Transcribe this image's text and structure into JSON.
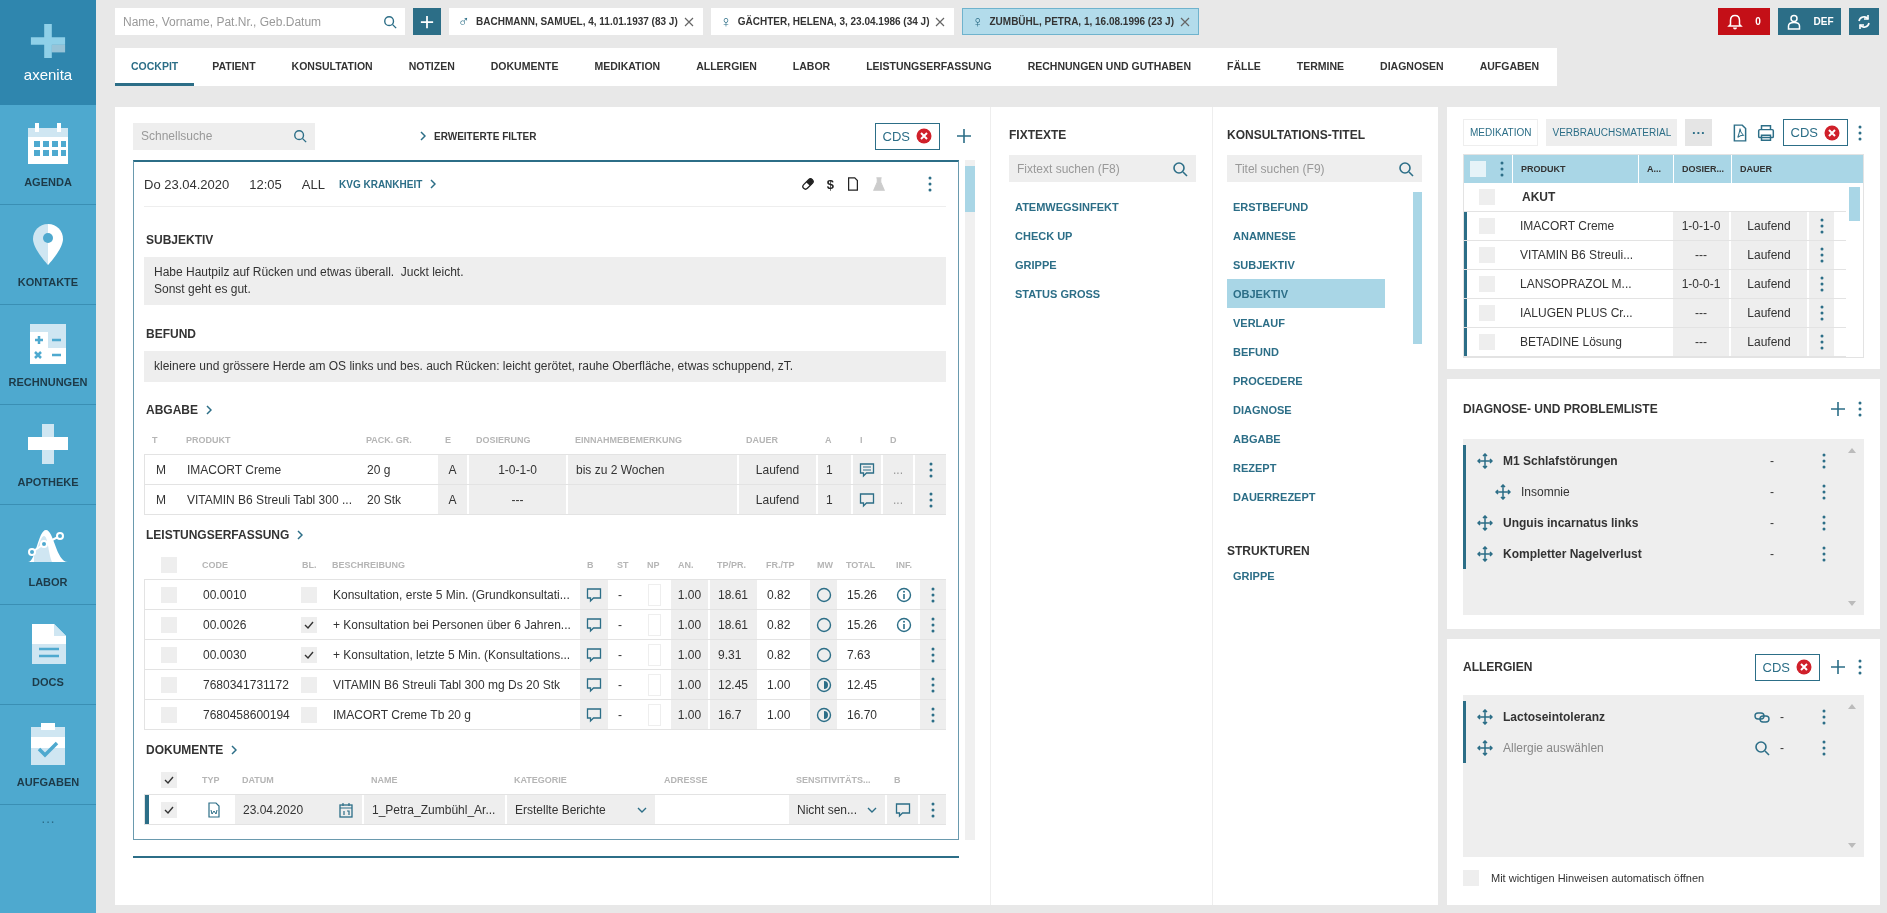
{
  "app": {
    "logo": "axenita"
  },
  "sidebar": {
    "items": [
      {
        "label": "AGENDA"
      },
      {
        "label": "KONTAKTE"
      },
      {
        "label": "RECHNUNGEN"
      },
      {
        "label": "APOTHEKE"
      },
      {
        "label": "LABOR"
      },
      {
        "label": "DOCS"
      },
      {
        "label": "AUFGABEN"
      }
    ],
    "more": "···"
  },
  "patient_search": {
    "placeholder": "Name, Vorname, Pat.Nr., Geb.Datum"
  },
  "patient_tabs": [
    {
      "symbol": "♂",
      "label": "BACHMANN, SAMUEL, 4, 11.01.1937 (83 J)",
      "selected": false
    },
    {
      "symbol": "♀",
      "label": "GÄCHTER, HELENA, 3, 23.04.1986 (34 J)",
      "selected": false
    },
    {
      "symbol": "♀",
      "label": "ZUMBÜHL, PETRA, 1, 16.08.1996 (23 J)",
      "selected": true
    }
  ],
  "notifications": {
    "count": "0"
  },
  "user": {
    "initials": "DEF"
  },
  "nav_tabs": [
    {
      "label": "COCKPIT",
      "selected": true
    },
    {
      "label": "PATIENT",
      "selected": false
    },
    {
      "label": "KONSULTATION",
      "selected": false
    },
    {
      "label": "NOTIZEN",
      "selected": false
    },
    {
      "label": "DOKUMENTE",
      "selected": false
    },
    {
      "label": "MEDIKATION",
      "selected": false
    },
    {
      "label": "ALLERGIEN",
      "selected": false
    },
    {
      "label": "LABOR",
      "selected": false
    },
    {
      "label": "LEISTUNGSERFASSUNG",
      "selected": false
    },
    {
      "label": "RECHNUNGEN UND GUTHABEN",
      "selected": false
    },
    {
      "label": "FÄLLE",
      "selected": false
    },
    {
      "label": "TERMINE",
      "selected": false
    },
    {
      "label": "DIAGNOSEN",
      "selected": false
    },
    {
      "label": "AUFGABEN",
      "selected": false
    }
  ],
  "consultation": {
    "quick_search": {
      "placeholder": "Schnellsuche"
    },
    "filter_link": "ERWEITERTE FILTER",
    "cds": "CDS",
    "entry": {
      "date": "Do 23.04.2020",
      "time": "12:05",
      "scope": "ALL",
      "case_link": "KVG KRANKHEIT",
      "actions": [
        {
          "kind": "pill",
          "disabled": false
        },
        {
          "kind": "text",
          "text": "$",
          "disabled": false
        },
        {
          "kind": "document",
          "disabled": false
        },
        {
          "kind": "flask",
          "disabled": true
        }
      ],
      "sections": [
        {
          "title": "SUBJEKTIV",
          "text": "Habe Hautpilz auf Rücken und etwas überall.  Juckt leicht.\nSonst geht es gut."
        },
        {
          "title": "BEFUND",
          "text": "kleinere und grössere Herde am OS links und bes. auch Rücken: leicht gerötet, rauhe Oberfläche, etwas schuppend, zT."
        }
      ],
      "abgabe": {
        "title": "ABGABE",
        "columns": [
          "T",
          "PRODUKT",
          "PACK. GR.",
          "E",
          "DOSIERUNG",
          "EINNAHMEBEMERKUNG",
          "DAUER",
          "A",
          "I",
          "D"
        ],
        "rows": [
          {
            "t": "M",
            "product": "IMACORT Creme",
            "pack": "20 g",
            "e": "A",
            "dosage": "1-0-1-0",
            "remark": "bis zu 2 Wochen",
            "duration": "Laufend",
            "a": "1",
            "comment": true,
            "d": "..."
          },
          {
            "t": "M",
            "product": "VITAMIN B6 Streuli Tabl 300 ...",
            "pack": "20 Stk",
            "e": "A",
            "dosage": "---",
            "remark": "",
            "duration": "Laufend",
            "a": "1",
            "comment": false,
            "d": "..."
          }
        ]
      },
      "leistungen": {
        "title": "LEISTUNGSERFASSUNG",
        "header_checked": false,
        "columns": [
          "CODE",
          "BL.",
          "BESCHREIBUNG",
          "B",
          "ST",
          "NP",
          "AN.",
          "TP/PR.",
          "FR./TP",
          "MW",
          "TOTAL",
          "INF."
        ],
        "rows": [
          {
            "checked": false,
            "code": "00.0010",
            "bl": false,
            "desc": "Konsultation, erste 5 Min. (Grundkonsultati...",
            "st": "-",
            "an": "1.00",
            "tp": "18.61",
            "fr": "0.82",
            "mw_half": false,
            "total": "15.26",
            "info": true
          },
          {
            "checked": false,
            "code": "00.0026",
            "bl": true,
            "desc": "+ Konsultation bei Personen über 6 Jahren...",
            "st": "-",
            "an": "1.00",
            "tp": "18.61",
            "fr": "0.82",
            "mw_half": false,
            "total": "15.26",
            "info": true
          },
          {
            "checked": false,
            "code": "00.0030",
            "bl": true,
            "desc": "+ Konsultation, letzte 5 Min. (Konsultations...",
            "st": "-",
            "an": "1.00",
            "tp": "9.31",
            "fr": "0.82",
            "mw_half": false,
            "total": "7.63",
            "info": false
          },
          {
            "checked": false,
            "code": "7680341731172",
            "bl": false,
            "desc": "VITAMIN B6 Streuli Tabl 300 mg Ds 20 Stk",
            "st": "-",
            "an": "1.00",
            "tp": "12.45",
            "fr": "1.00",
            "mw_half": true,
            "total": "12.45",
            "info": false
          },
          {
            "checked": false,
            "code": "7680458600194",
            "bl": false,
            "desc": "IMACORT Creme Tb 20 g",
            "st": "-",
            "an": "1.00",
            "tp": "16.7",
            "fr": "1.00",
            "mw_half": true,
            "total": "16.70",
            "info": false
          }
        ]
      },
      "dokumente": {
        "title": "DOKUMENTE",
        "header_checked": true,
        "columns": [
          "TYP",
          "DATUM",
          "NAME",
          "KATEGORIE",
          "ADRESSE",
          "SENSITIVITÄTS...",
          "B"
        ],
        "rows": [
          {
            "checked": true,
            "date": "23.04.2020",
            "name": "1_Petra_Zumbühl_Ar...",
            "category": "Erstellte Berichte",
            "address": "",
            "sensitivity": "Nicht sen..."
          }
        ]
      }
    }
  },
  "fixtexte": {
    "title": "FIXTEXTE",
    "search_placeholder": "Fixtext suchen (F8)",
    "items": [
      "ATEMWEGSINFEKT",
      "CHECK UP",
      "GRIPPE",
      "STATUS GROSS"
    ]
  },
  "titles": {
    "title": "KONSULTATIONS-TITEL",
    "search_placeholder": "Titel suchen (F9)",
    "items": [
      {
        "label": "ERSTBEFUND",
        "selected": false
      },
      {
        "label": "ANAMNESE",
        "selected": false
      },
      {
        "label": "SUBJEKTIV",
        "selected": false
      },
      {
        "label": "OBJEKTIV",
        "selected": true
      },
      {
        "label": "VERLAUF",
        "selected": false
      },
      {
        "label": "BEFUND",
        "selected": false
      },
      {
        "label": "PROCEDERE",
        "selected": false
      },
      {
        "label": "DIAGNOSE",
        "selected": false
      },
      {
        "label": "ABGABE",
        "selected": false
      },
      {
        "label": "REZEPT",
        "selected": false
      },
      {
        "label": "DAUERREZEPT",
        "selected": false
      }
    ],
    "structures_title": "STRUKTUREN",
    "structures": [
      "GRIPPE"
    ]
  },
  "medication": {
    "tabs": [
      {
        "label": "MEDIKATION",
        "selected": true
      },
      {
        "label": "VERBRAUCHSMATERIAL",
        "selected": false
      }
    ],
    "more": "···",
    "cds": "CDS",
    "header_checked": false,
    "columns": [
      "PRODUKT",
      "A...",
      "DOSIER...",
      "DAUER"
    ],
    "rows": [
      {
        "kind": "group",
        "product": "AKUT",
        "checked": false
      },
      {
        "kind": "item",
        "product": "IMACORT Creme",
        "dosage": "1-0-1-0",
        "duration": "Laufend",
        "checked": false
      },
      {
        "kind": "item",
        "product": "VITAMIN B6 Streuli...",
        "dosage": "---",
        "duration": "Laufend",
        "checked": false
      },
      {
        "kind": "item",
        "product": "LANSOPRAZOL M...",
        "dosage": "1-0-0-1",
        "duration": "Laufend",
        "checked": false
      },
      {
        "kind": "item",
        "product": "IALUGEN PLUS Cr...",
        "dosage": "---",
        "duration": "Laufend",
        "checked": false
      },
      {
        "kind": "item",
        "product": "BETADINE Lösung",
        "dosage": "---",
        "duration": "Laufend",
        "checked": false
      }
    ]
  },
  "diagnoses": {
    "title": "DIAGNOSE- UND PROBLEMLISTE",
    "items": [
      {
        "label": "M1 Schlafstörungen",
        "value": "-",
        "children": [
          {
            "label": "Insomnie",
            "value": "-"
          }
        ]
      },
      {
        "label": "Unguis incarnatus links",
        "value": "-"
      },
      {
        "label": "Kompletter Nagelverlust",
        "value": "-"
      }
    ]
  },
  "allergies": {
    "title": "ALLERGIEN",
    "cds": "CDS",
    "items": [
      {
        "kind": "entry",
        "label": "Lactoseintoleranz",
        "value": "-"
      },
      {
        "kind": "picker",
        "label": "Allergie auswählen",
        "value": "-"
      }
    ],
    "auto_open": {
      "label": "Mit wichtigen Hinweisen automatisch öffnen",
      "checked": false
    }
  }
}
